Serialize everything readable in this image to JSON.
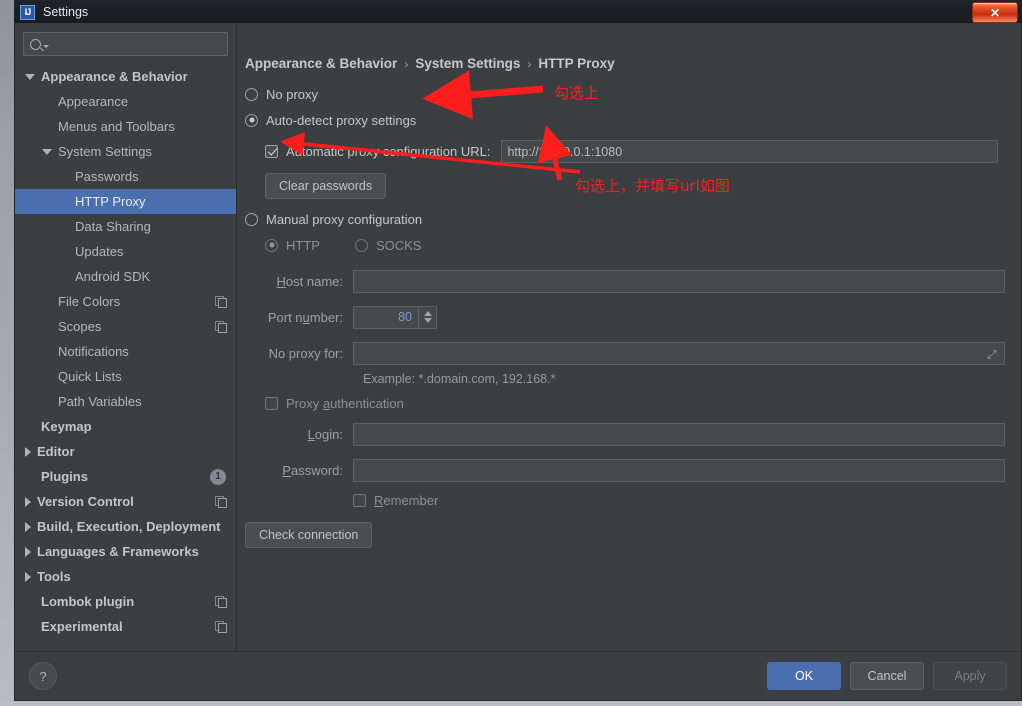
{
  "window": {
    "title": "Settings",
    "app_icon": "intellij-idea-icon",
    "close_label": "✕"
  },
  "sidebar": {
    "search": {
      "value": "",
      "placeholder": ""
    },
    "items": [
      {
        "label": "Appearance & Behavior",
        "indent": 0,
        "twisty": "down",
        "bold": true,
        "selected": false,
        "right": ""
      },
      {
        "label": "Appearance",
        "indent": 1,
        "twisty": "none",
        "bold": false,
        "selected": false,
        "right": ""
      },
      {
        "label": "Menus and Toolbars",
        "indent": 1,
        "twisty": "none",
        "bold": false,
        "selected": false,
        "right": ""
      },
      {
        "label": "System Settings",
        "indent": 1,
        "twisty": "down",
        "bold": false,
        "selected": false,
        "right": ""
      },
      {
        "label": "Passwords",
        "indent": 2,
        "twisty": "none",
        "bold": false,
        "selected": false,
        "right": ""
      },
      {
        "label": "HTTP Proxy",
        "indent": 2,
        "twisty": "none",
        "bold": false,
        "selected": true,
        "right": ""
      },
      {
        "label": "Data Sharing",
        "indent": 2,
        "twisty": "none",
        "bold": false,
        "selected": false,
        "right": ""
      },
      {
        "label": "Updates",
        "indent": 2,
        "twisty": "none",
        "bold": false,
        "selected": false,
        "right": ""
      },
      {
        "label": "Android SDK",
        "indent": 2,
        "twisty": "none",
        "bold": false,
        "selected": false,
        "right": ""
      },
      {
        "label": "File Colors",
        "indent": 1,
        "twisty": "none",
        "bold": false,
        "selected": false,
        "right": "copy"
      },
      {
        "label": "Scopes",
        "indent": 1,
        "twisty": "none",
        "bold": false,
        "selected": false,
        "right": "copy"
      },
      {
        "label": "Notifications",
        "indent": 1,
        "twisty": "none",
        "bold": false,
        "selected": false,
        "right": ""
      },
      {
        "label": "Quick Lists",
        "indent": 1,
        "twisty": "none",
        "bold": false,
        "selected": false,
        "right": ""
      },
      {
        "label": "Path Variables",
        "indent": 1,
        "twisty": "none",
        "bold": false,
        "selected": false,
        "right": ""
      },
      {
        "label": "Keymap",
        "indent": 0,
        "twisty": "none",
        "bold": true,
        "selected": false,
        "right": ""
      },
      {
        "label": "Editor",
        "indent": 0,
        "twisty": "right",
        "bold": true,
        "selected": false,
        "right": ""
      },
      {
        "label": "Plugins",
        "indent": 0,
        "twisty": "none",
        "bold": true,
        "selected": false,
        "right": "badge",
        "badge": "1"
      },
      {
        "label": "Version Control",
        "indent": 0,
        "twisty": "right",
        "bold": true,
        "selected": false,
        "right": "copy"
      },
      {
        "label": "Build, Execution, Deployment",
        "indent": 0,
        "twisty": "right",
        "bold": true,
        "selected": false,
        "right": ""
      },
      {
        "label": "Languages & Frameworks",
        "indent": 0,
        "twisty": "right",
        "bold": true,
        "selected": false,
        "right": ""
      },
      {
        "label": "Tools",
        "indent": 0,
        "twisty": "right",
        "bold": true,
        "selected": false,
        "right": ""
      },
      {
        "label": "Lombok plugin",
        "indent": 0,
        "twisty": "none",
        "bold": true,
        "selected": false,
        "right": "copy"
      },
      {
        "label": "Experimental",
        "indent": 0,
        "twisty": "none",
        "bold": true,
        "selected": false,
        "right": "copy"
      }
    ]
  },
  "breadcrumb": {
    "part1": "Appearance & Behavior",
    "sep1": "›",
    "part2": "System Settings",
    "sep2": "›",
    "part3": "HTTP Proxy"
  },
  "main": {
    "no_proxy_label": "No proxy",
    "no_proxy_selected": false,
    "auto_detect_label": "Auto-detect proxy settings",
    "auto_detect_selected": true,
    "auto_config_checkbox_label": "Automatic proxy configuration URL:",
    "auto_config_checked": true,
    "auto_config_url": "http://127.0.0.1:1080",
    "clear_passwords_label": "Clear passwords",
    "manual_proxy_label": "Manual proxy configuration",
    "manual_proxy_selected": false,
    "http_label": "HTTP",
    "http_selected": true,
    "socks_label": "SOCKS",
    "socks_selected": false,
    "host_name_label": "Host name:",
    "host_name_value": "",
    "port_number_label": "Port number:",
    "port_number_value": "80",
    "no_proxy_for_label": "No proxy for:",
    "no_proxy_for_value": "",
    "example_text": "Example: *.domain.com, 192.168.*",
    "proxy_auth_label": "Proxy authentication",
    "proxy_auth_checked": false,
    "login_label": "Login:",
    "login_value": "",
    "password_label": "Password:",
    "password_value": "",
    "remember_label": "Remember",
    "remember_checked": false,
    "check_connection_label": "Check connection"
  },
  "footer": {
    "help_label": "?",
    "ok_label": "OK",
    "cancel_label": "Cancel",
    "apply_label": "Apply"
  },
  "annotations": {
    "note1": "勾选上",
    "note2": "勾选上，并填写url如图",
    "color": "#fc1d1d"
  }
}
